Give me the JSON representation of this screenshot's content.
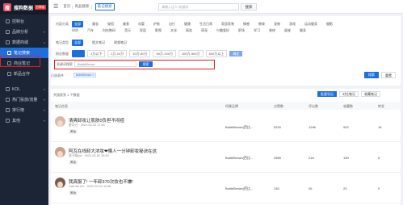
{
  "app": {
    "logo_char": "搜",
    "name": "搜狗数据",
    "tag": "分享版"
  },
  "sidebar": {
    "items": [
      {
        "label": "控制台",
        "icon": "dashboard-icon"
      },
      {
        "label": "品牌分析",
        "icon": "brand-icon"
      },
      {
        "label": "数据商城",
        "icon": "store-icon"
      },
      {
        "label": "笔记搜索",
        "icon": "note-search-icon"
      },
      {
        "label": "商业笔记",
        "icon": "business-note-icon"
      },
      {
        "label": "新品合作",
        "icon": "cooperation-icon"
      },
      {
        "label": "KOL",
        "icon": "kol-icon"
      },
      {
        "label": "热门投放/流量",
        "icon": "traffic-icon"
      },
      {
        "label": "排行榜",
        "icon": "ranking-icon"
      },
      {
        "label": "其他",
        "icon": "other-icon"
      }
    ]
  },
  "topbar": {
    "crumbs": [
      "首页",
      "商品搜索",
      "笔记搜索"
    ],
    "search_placeholder": "请输入达人/关键词",
    "search_button": "搜索"
  },
  "filters": {
    "category": {
      "label": "内容分类",
      "options": [
        "全部",
        "美妆",
        "穿搭",
        "美食",
        "母婴",
        "护肤",
        "出行",
        "健康",
        "生活日常",
        "家居家装",
        "情感",
        "教育",
        "宠物",
        "游戏",
        "运动健身",
        "摄影"
      ],
      "options2": [
        "时尚",
        "汽车",
        "科技数码",
        "音乐",
        "家居",
        "影视",
        "文化",
        "搞笑",
        "萌宠",
        "兴趣爱好",
        "职场",
        "学习",
        "装修",
        "星座",
        "健身"
      ]
    },
    "note_type": {
      "label": "笔记类型",
      "options": [
        "全部",
        "图文笔记",
        "视频笔记"
      ]
    },
    "fans": {
      "label": "粉丝数量",
      "options": [
        "全部",
        "1万以下",
        "1万-10万",
        "10万-50万",
        "50万-100万",
        "100万-500万",
        "500万以上"
      ],
      "confirm": "确定"
    },
    "keyword": {
      "label": "关键词搜索",
      "value": "BobbiBrown",
      "button": "搜索"
    },
    "blogger": {
      "label": "已选条件",
      "tag": "BobbiBrown ×"
    },
    "search_button": "搜索",
    "reset_button": "重置"
  },
  "results": {
    "count_text": "共搜索到 1 个数据",
    "buttons": {
      "export": "批量导出",
      "compare": "对比笔记",
      "collect": "收藏笔记"
    },
    "columns": [
      "笔记信息",
      "所属品牌",
      "点赞数",
      "评论数",
      "收藏数",
      "转发"
    ],
    "rows": [
      {
        "title": "清爽卸妆让肌肤0负担不闷痘",
        "meta": "星次元 · 2021-02-02 17:50",
        "tag": "美妆",
        "brand": "BobbiBrown(芭比...",
        "likes": "5220",
        "comments": "1296",
        "favorites": "932",
        "shares": "16"
      },
      {
        "title": "阿瓦在线卸大浓妆❤懒人一分钟卸妆秘诀在这",
        "meta": "张子曦yoi · 2021-02-01 15:20",
        "tag": "美妆",
        "brand": "BobbiBrown(芭比...",
        "likes": "2569",
        "comments": "216",
        "favorites": "130",
        "shares": "5"
      },
      {
        "title": "我真服了! 一年卸370次妆也不嫌!",
        "meta": "Call me UV · 2021-02-01 11:06",
        "tag": "美妆",
        "brand": "BobbiBrown(芭比...",
        "likes": "130",
        "comments": "26",
        "favorites": "23",
        "shares": "0"
      }
    ]
  },
  "colors": {
    "primary": "#1d6fe0",
    "sidebar_bg": "#1c2536",
    "highlight": "#e02020"
  }
}
